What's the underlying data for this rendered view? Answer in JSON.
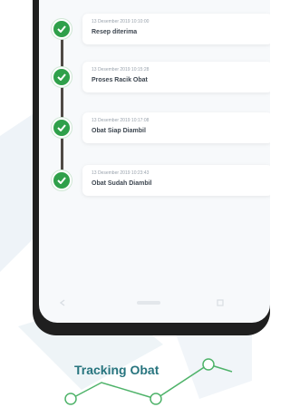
{
  "timeline": {
    "events": [
      {
        "timestamp": "13 Desember 2019 10:10:00",
        "status": "Resep diterima"
      },
      {
        "timestamp": "13 Desember 2019 10:15:28",
        "status": "Proses Racik Obat"
      },
      {
        "timestamp": "13 Desember 2019 10:17:08",
        "status": "Obat Siap Diambil"
      },
      {
        "timestamp": "13 Desember 2019 10:23:43",
        "status": "Obat Sudah Diambil"
      }
    ]
  },
  "caption": "Tracking Obat",
  "colors": {
    "check_green": "#2fa04a",
    "caption_teal": "#27747e",
    "deco_green": "#4fb36a",
    "phone_frame": "#1f1f1f"
  },
  "icons": {
    "step_marker": "check-icon",
    "nav_back": "back-icon",
    "nav_recent": "recent-apps-icon"
  }
}
